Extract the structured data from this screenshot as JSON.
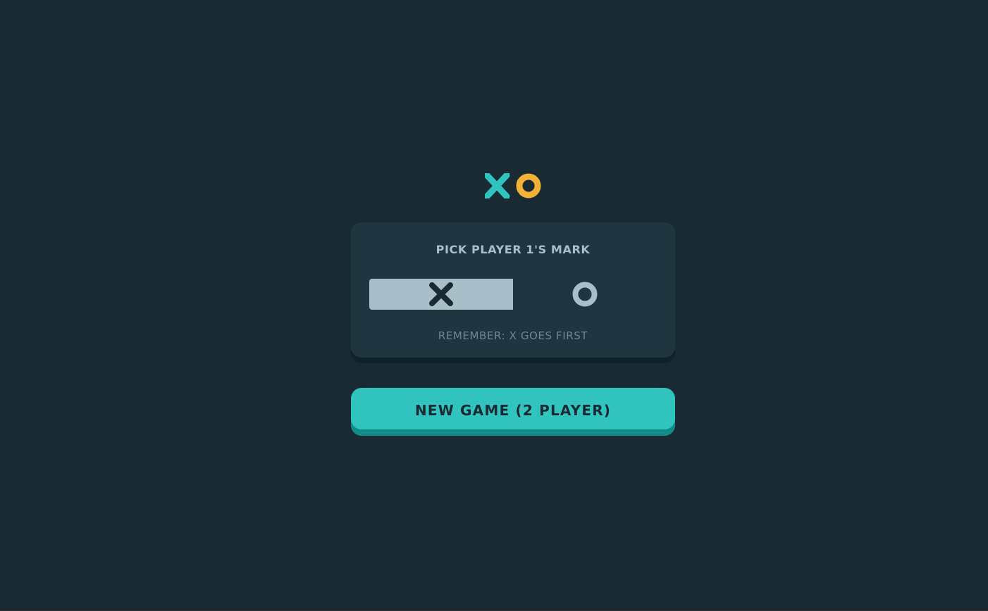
{
  "logo": {
    "x_icon": "x-mark-icon",
    "o_icon": "o-mark-icon",
    "x_color": "#31c3bd",
    "o_color": "#f2b137"
  },
  "mark_picker": {
    "title": "PICK PLAYER 1'S MARK",
    "options": [
      {
        "mark": "X",
        "icon": "x-mark-icon",
        "selected": true
      },
      {
        "mark": "O",
        "icon": "o-mark-icon",
        "selected": false
      }
    ],
    "hint": "REMEMBER: X GOES FIRST"
  },
  "actions": {
    "new_game_label": "NEW GAME (2 PLAYER)"
  },
  "colors": {
    "background": "#1a2a33",
    "card": "#1f3641",
    "silver": "#a8bfc9",
    "teal": "#31c3bd",
    "teal_shadow": "#118c87",
    "yellow": "#f2b137"
  }
}
